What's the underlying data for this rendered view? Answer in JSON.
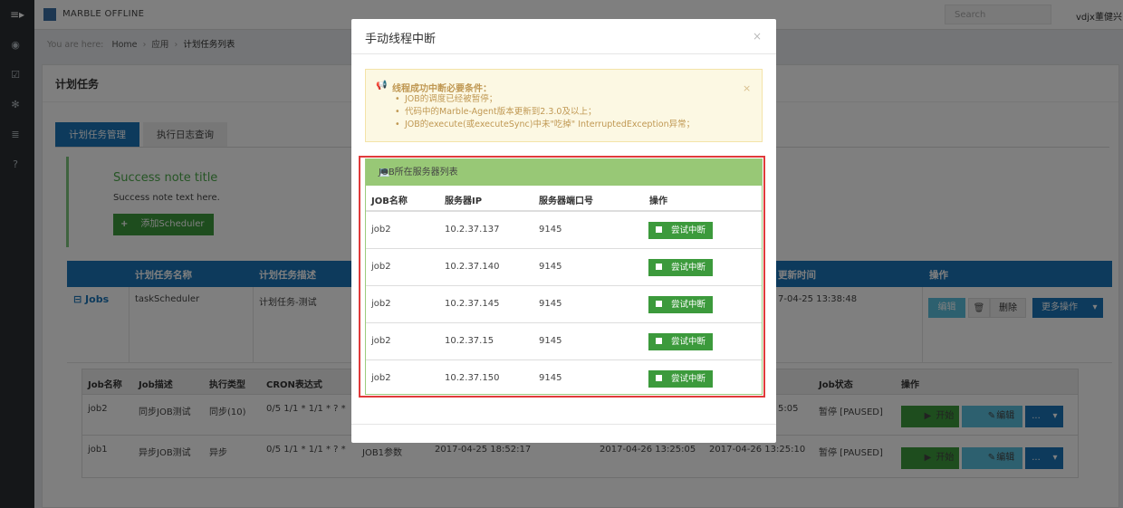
{
  "topbar": {
    "brand": "MARBLE OFFLINE",
    "search_placeholder": "Search",
    "user": "vdjx董健兴",
    "menu_icon": "≡▸"
  },
  "breadcrumb": {
    "prefix": "You are here:",
    "home": "Home",
    "app": "应用",
    "current": "计划任务列表",
    "sep": "›"
  },
  "page": {
    "title": "计划任务",
    "tabs": [
      "计划任务管理",
      "执行日志查询"
    ]
  },
  "note": {
    "title": "Success note title",
    "text": "Success note text here.",
    "add_button": "添加Scheduler"
  },
  "main_table": {
    "headers": [
      "计划任务名称",
      "计划任务描述",
      "更新时间",
      "操作"
    ],
    "row": {
      "toggle": "Jobs",
      "name": "taskScheduler",
      "desc": "计划任务-测试",
      "updated": "7-04-25 13:38:48"
    },
    "buttons": {
      "edit": "编辑",
      "delete": "删除",
      "more": "更多操作"
    }
  },
  "job_table": {
    "headers": [
      "Job名称",
      "Job描述",
      "执行类型",
      "CRON表达式",
      "Job状态",
      "操作"
    ],
    "rows": [
      {
        "name": "job2",
        "desc": "同步JOB测试",
        "type": "同步(10)",
        "cron": "0/5 1/1 * 1/1 * ? *",
        "t3": "5:05",
        "status": "暂停 [PAUSED]"
      },
      {
        "name": "job1",
        "desc": "异步JOB测试",
        "type": "异步",
        "cron": "0/5 1/1 * 1/1 * ? *",
        "param": "JOB1参数",
        "t1": "2017-04-25 18:52:17",
        "t2": "2017-04-26 13:25:05",
        "t3": "2017-04-26 13:25:10",
        "status": "暂停 [PAUSED]"
      }
    ],
    "buttons": {
      "start": "开始",
      "edit": "编辑",
      "dots": "..."
    }
  },
  "modal": {
    "title": "手动线程中断",
    "close": "×",
    "warning": {
      "title": "线程成功中断必要条件：",
      "items": [
        "JOB的调度已经被暂停；",
        "代码中的Marble-Agent版本更新到2.3.0及以上；",
        "JOB的execute(或executeSync)中未\"吃掉\" InterruptedException异常；"
      ],
      "close": "×"
    },
    "server_panel": {
      "title": "JOB所在服务器列表",
      "columns": [
        "JOB名称",
        "服务器IP",
        "服务器端口号",
        "操作"
      ],
      "rows": [
        {
          "job": "job2",
          "ip": "10.2.37.137",
          "port": "9145",
          "action": "尝试中断"
        },
        {
          "job": "job2",
          "ip": "10.2.37.140",
          "port": "9145",
          "action": "尝试中断"
        },
        {
          "job": "job2",
          "ip": "10.2.37.145",
          "port": "9145",
          "action": "尝试中断"
        },
        {
          "job": "job2",
          "ip": "10.2.37.15",
          "port": "9145",
          "action": "尝试中断"
        },
        {
          "job": "job2",
          "ip": "10.2.37.150",
          "port": "9145",
          "action": "尝试中断"
        }
      ]
    }
  },
  "colors": {
    "primary": "#1a75b8",
    "success": "#3c9a3c",
    "info": "#5bc0de",
    "panel_green": "#98c876",
    "highlight_red": "#e03b3b"
  }
}
